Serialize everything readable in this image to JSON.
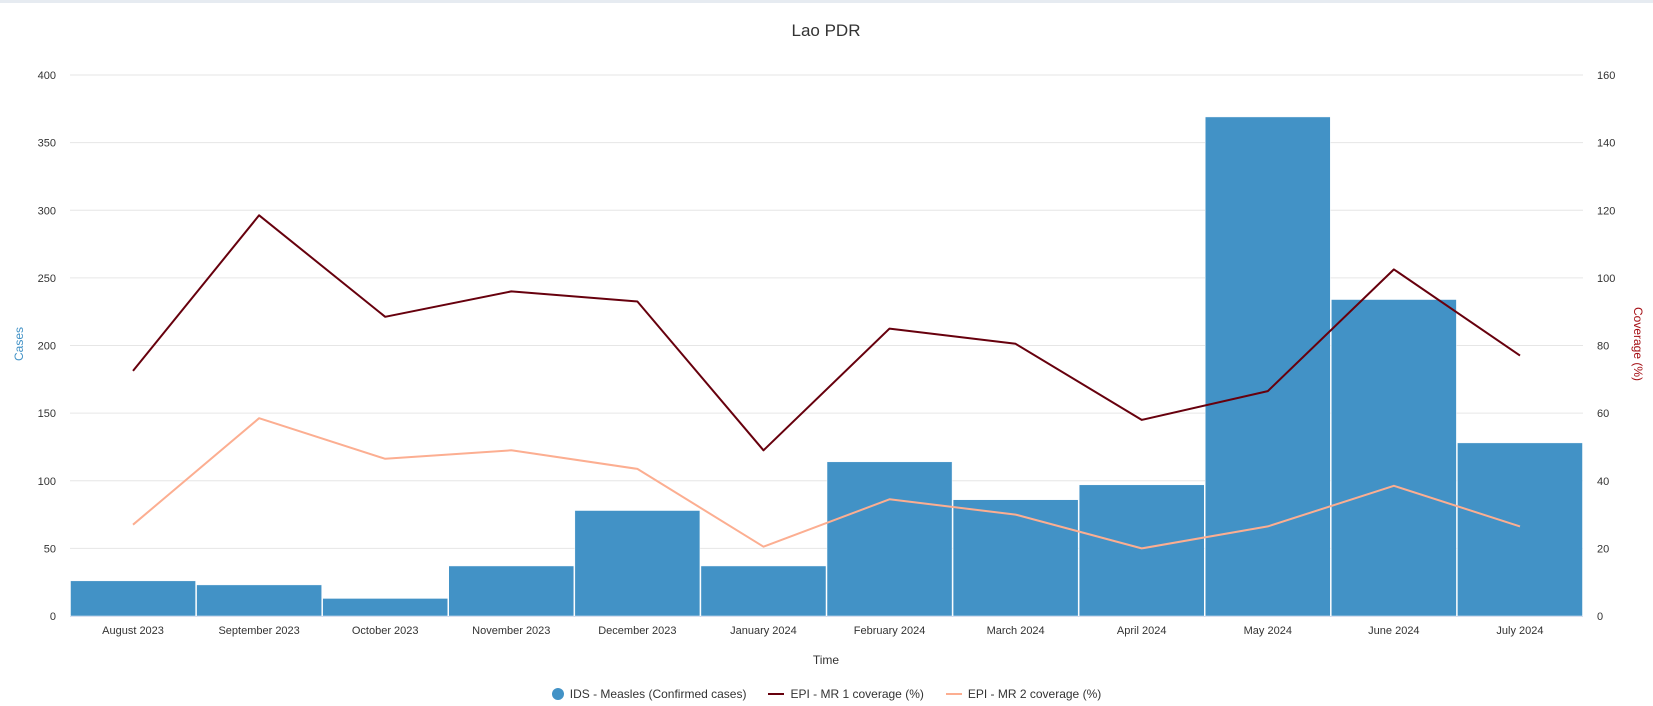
{
  "chart_data": {
    "type": "bar",
    "title": "Lao PDR",
    "xlabel": "Time",
    "ylabel": "Cases",
    "y2label": "Coverage (%)",
    "ylim": [
      0,
      400
    ],
    "y2lim": [
      0,
      160
    ],
    "yticks": [
      0,
      50,
      100,
      150,
      200,
      250,
      300,
      350,
      400
    ],
    "y2ticks": [
      0,
      20,
      40,
      60,
      80,
      100,
      120,
      140,
      160
    ],
    "categories": [
      "August 2023",
      "September 2023",
      "October 2023",
      "November 2023",
      "December 2023",
      "January 2024",
      "February 2024",
      "March 2024",
      "April 2024",
      "May 2024",
      "June 2024",
      "July 2024"
    ],
    "legend_position": "bottom-center",
    "grid": true,
    "series": [
      {
        "name": "IDS - Measles (Confirmed cases)",
        "type": "bar",
        "axis": "left",
        "color": "#4292c6",
        "values": [
          26,
          23,
          13,
          37,
          78,
          37,
          114,
          86,
          97,
          369,
          234,
          128
        ]
      },
      {
        "name": "EPI - MR 1 coverage (%)",
        "type": "line",
        "axis": "right",
        "color": "#67000d",
        "values": [
          72.5,
          118.5,
          88.5,
          96,
          93,
          49,
          85,
          80.5,
          58,
          66.5,
          102.5,
          77
        ]
      },
      {
        "name": "EPI - MR 2 coverage (%)",
        "type": "line",
        "axis": "right",
        "color": "#fcae91",
        "values": [
          27,
          58.5,
          46.5,
          49,
          43.5,
          20.5,
          34.5,
          30,
          20,
          26.5,
          38.5,
          26.5
        ]
      }
    ]
  },
  "colors": {
    "axis_left_title": "#4292c6",
    "axis_right_title": "#a50f15",
    "grid": "#e6e6e6",
    "bar_border": "#ffffff"
  }
}
